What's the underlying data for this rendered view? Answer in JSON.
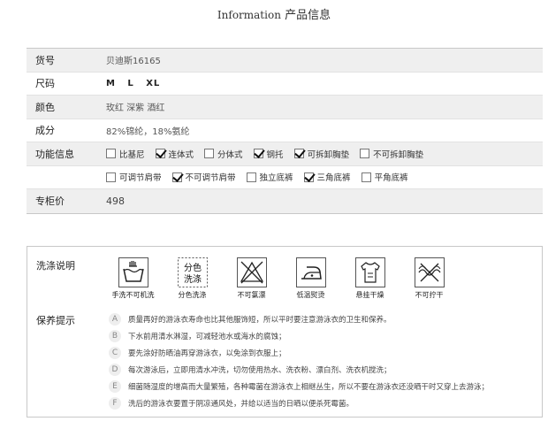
{
  "header": {
    "title_en": "Information",
    "title_cn": "产品信息"
  },
  "spec": {
    "item_no": {
      "label": "货号",
      "value": "贝迪斯16165"
    },
    "size": {
      "label": "尺码",
      "value": "M   L   XL"
    },
    "color": {
      "label": "颜色",
      "value": "玫红  深紫  酒红"
    },
    "material": {
      "label": "成分",
      "value": "82%锦纶，18%氨纶"
    },
    "features": {
      "label": "功能信息",
      "row1": [
        {
          "label": "比基尼",
          "checked": false
        },
        {
          "label": "连体式",
          "checked": true
        },
        {
          "label": "分体式",
          "checked": false
        },
        {
          "label": "钢托",
          "checked": true
        },
        {
          "label": "可拆卸胸垫",
          "checked": true
        },
        {
          "label": "不可拆卸胸垫",
          "checked": false
        }
      ],
      "row2": [
        {
          "label": "可调节肩带",
          "checked": false
        },
        {
          "label": "不可调节肩带",
          "checked": true
        },
        {
          "label": "独立底裤",
          "checked": false
        },
        {
          "label": "三角底裤",
          "checked": true
        },
        {
          "label": "平角底裤",
          "checked": false
        }
      ]
    },
    "price": {
      "label": "专柜价",
      "value": "498"
    }
  },
  "care": {
    "wash_label": "洗涤说明",
    "icons": [
      {
        "icon": "hand-wash-icon",
        "label": "手洗不可机洗"
      },
      {
        "icon": "separate-wash-icon",
        "label": "分色洗涤",
        "glyph_line1": "分色",
        "glyph_line2": "洗涤"
      },
      {
        "icon": "no-bleach-icon",
        "label": "不可氯漂"
      },
      {
        "icon": "low-iron-icon",
        "label": "低温熨烫"
      },
      {
        "icon": "hang-dry-icon",
        "label": "悬挂干燥"
      },
      {
        "icon": "no-wring-icon",
        "label": "不可拧干"
      }
    ],
    "tips_label": "保养提示",
    "tips": [
      {
        "letter": "A",
        "text": "质量再好的游泳衣寿命也比其他服饰短，所以平时要注意游泳衣的卫生和保养。"
      },
      {
        "letter": "B",
        "text": "下水前用清水淋湿，可减轻池水或海水的腐蚀；"
      },
      {
        "letter": "C",
        "text": "要先涂好防晒油再穿游泳衣，以免涂到衣服上；"
      },
      {
        "letter": "D",
        "text": "每次游泳后，立即用清水冲洗，切勿使用热水、洗衣粉、漂白剂、洗衣机搅洗；"
      },
      {
        "letter": "E",
        "text": "细菌随湿度的增高而大量繁殖，各种霉菌在游泳衣上相继丛生，所以不要在游泳衣还没晒干时又穿上去游泳；"
      },
      {
        "letter": "F",
        "text": "洗后的游泳衣要置于阴凉通风处，并给以适当的日晒以便杀死霉菌。"
      }
    ]
  }
}
